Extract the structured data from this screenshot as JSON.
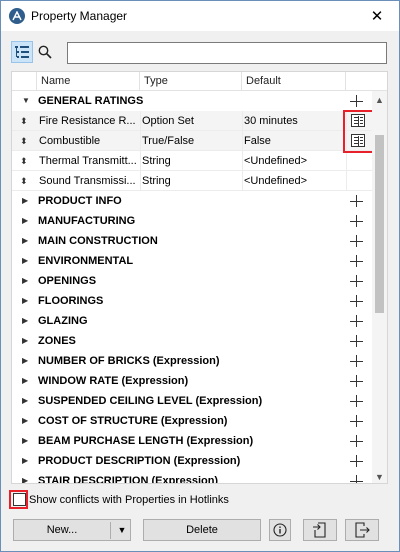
{
  "window": {
    "title": "Property Manager",
    "close_glyph": "✕"
  },
  "toolbar": {
    "search": {
      "value": "",
      "placeholder": ""
    }
  },
  "table": {
    "columns": {
      "name": "Name",
      "type": "Type",
      "default": "Default"
    },
    "general_group": "GENERAL RATINGS",
    "properties": [
      {
        "name": "Fire Resistance R...",
        "type": "Option Set",
        "default": "30 minutes",
        "has_details_icon": true
      },
      {
        "name": "Combustible",
        "type": "True/False",
        "default": "False",
        "has_details_icon": true
      },
      {
        "name": "Thermal Transmitt...",
        "type": "String",
        "default": "<Undefined>",
        "has_details_icon": false
      },
      {
        "name": "Sound Transmissi...",
        "type": "String",
        "default": "<Undefined>",
        "has_details_icon": false
      }
    ],
    "groups": [
      "PRODUCT INFO",
      "MANUFACTURING",
      "MAIN CONSTRUCTION",
      "ENVIRONMENTAL",
      "OPENINGS",
      "FLOORINGS",
      "GLAZING",
      "ZONES",
      "NUMBER OF BRICKS (Expression)",
      "WINDOW RATE (Expression)",
      "SUSPENDED CEILING LEVEL (Expression)",
      "COST OF STRUCTURE (Expression)",
      "BEAM PURCHASE LENGTH (Expression)",
      "PRODUCT DESCRIPTION (Expression)",
      "STAIR DESCRIPTION (Expression)"
    ]
  },
  "footer": {
    "show_conflicts_label": "Show conflicts with Properties in Hotlinks",
    "show_conflicts_checked": false,
    "new_label": "New...",
    "delete_label": "Delete"
  },
  "icons": {
    "app": "archicad-icon",
    "view_toggle": "list-tree-icon",
    "search": "search-icon",
    "details": "property-details-icon",
    "info": "info-icon",
    "import": "import-icon",
    "export": "export-icon"
  },
  "colors": {
    "highlight": "#e8202a",
    "accent": "#cce4f7"
  }
}
